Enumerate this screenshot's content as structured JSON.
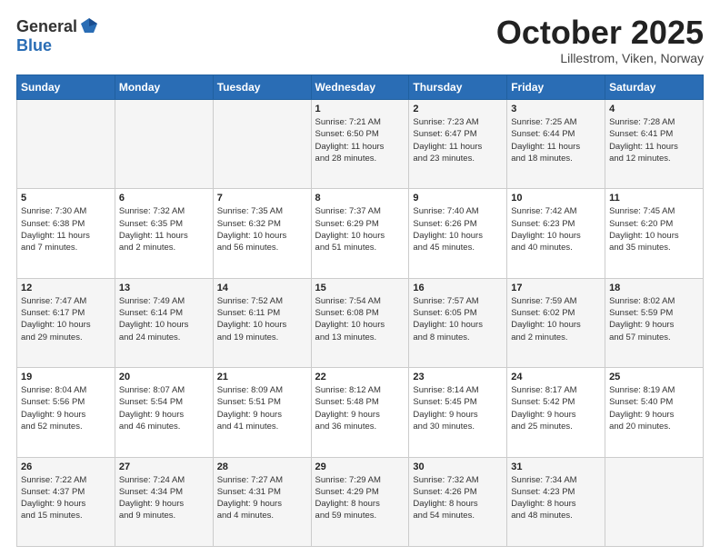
{
  "header": {
    "logo_general": "General",
    "logo_blue": "Blue",
    "month_title": "October 2025",
    "location": "Lillestrom, Viken, Norway"
  },
  "weekdays": [
    "Sunday",
    "Monday",
    "Tuesday",
    "Wednesday",
    "Thursday",
    "Friday",
    "Saturday"
  ],
  "weeks": [
    [
      {
        "day": "",
        "info": ""
      },
      {
        "day": "",
        "info": ""
      },
      {
        "day": "",
        "info": ""
      },
      {
        "day": "1",
        "info": "Sunrise: 7:21 AM\nSunset: 6:50 PM\nDaylight: 11 hours\nand 28 minutes."
      },
      {
        "day": "2",
        "info": "Sunrise: 7:23 AM\nSunset: 6:47 PM\nDaylight: 11 hours\nand 23 minutes."
      },
      {
        "day": "3",
        "info": "Sunrise: 7:25 AM\nSunset: 6:44 PM\nDaylight: 11 hours\nand 18 minutes."
      },
      {
        "day": "4",
        "info": "Sunrise: 7:28 AM\nSunset: 6:41 PM\nDaylight: 11 hours\nand 12 minutes."
      }
    ],
    [
      {
        "day": "5",
        "info": "Sunrise: 7:30 AM\nSunset: 6:38 PM\nDaylight: 11 hours\nand 7 minutes."
      },
      {
        "day": "6",
        "info": "Sunrise: 7:32 AM\nSunset: 6:35 PM\nDaylight: 11 hours\nand 2 minutes."
      },
      {
        "day": "7",
        "info": "Sunrise: 7:35 AM\nSunset: 6:32 PM\nDaylight: 10 hours\nand 56 minutes."
      },
      {
        "day": "8",
        "info": "Sunrise: 7:37 AM\nSunset: 6:29 PM\nDaylight: 10 hours\nand 51 minutes."
      },
      {
        "day": "9",
        "info": "Sunrise: 7:40 AM\nSunset: 6:26 PM\nDaylight: 10 hours\nand 45 minutes."
      },
      {
        "day": "10",
        "info": "Sunrise: 7:42 AM\nSunset: 6:23 PM\nDaylight: 10 hours\nand 40 minutes."
      },
      {
        "day": "11",
        "info": "Sunrise: 7:45 AM\nSunset: 6:20 PM\nDaylight: 10 hours\nand 35 minutes."
      }
    ],
    [
      {
        "day": "12",
        "info": "Sunrise: 7:47 AM\nSunset: 6:17 PM\nDaylight: 10 hours\nand 29 minutes."
      },
      {
        "day": "13",
        "info": "Sunrise: 7:49 AM\nSunset: 6:14 PM\nDaylight: 10 hours\nand 24 minutes."
      },
      {
        "day": "14",
        "info": "Sunrise: 7:52 AM\nSunset: 6:11 PM\nDaylight: 10 hours\nand 19 minutes."
      },
      {
        "day": "15",
        "info": "Sunrise: 7:54 AM\nSunset: 6:08 PM\nDaylight: 10 hours\nand 13 minutes."
      },
      {
        "day": "16",
        "info": "Sunrise: 7:57 AM\nSunset: 6:05 PM\nDaylight: 10 hours\nand 8 minutes."
      },
      {
        "day": "17",
        "info": "Sunrise: 7:59 AM\nSunset: 6:02 PM\nDaylight: 10 hours\nand 2 minutes."
      },
      {
        "day": "18",
        "info": "Sunrise: 8:02 AM\nSunset: 5:59 PM\nDaylight: 9 hours\nand 57 minutes."
      }
    ],
    [
      {
        "day": "19",
        "info": "Sunrise: 8:04 AM\nSunset: 5:56 PM\nDaylight: 9 hours\nand 52 minutes."
      },
      {
        "day": "20",
        "info": "Sunrise: 8:07 AM\nSunset: 5:54 PM\nDaylight: 9 hours\nand 46 minutes."
      },
      {
        "day": "21",
        "info": "Sunrise: 8:09 AM\nSunset: 5:51 PM\nDaylight: 9 hours\nand 41 minutes."
      },
      {
        "day": "22",
        "info": "Sunrise: 8:12 AM\nSunset: 5:48 PM\nDaylight: 9 hours\nand 36 minutes."
      },
      {
        "day": "23",
        "info": "Sunrise: 8:14 AM\nSunset: 5:45 PM\nDaylight: 9 hours\nand 30 minutes."
      },
      {
        "day": "24",
        "info": "Sunrise: 8:17 AM\nSunset: 5:42 PM\nDaylight: 9 hours\nand 25 minutes."
      },
      {
        "day": "25",
        "info": "Sunrise: 8:19 AM\nSunset: 5:40 PM\nDaylight: 9 hours\nand 20 minutes."
      }
    ],
    [
      {
        "day": "26",
        "info": "Sunrise: 7:22 AM\nSunset: 4:37 PM\nDaylight: 9 hours\nand 15 minutes."
      },
      {
        "day": "27",
        "info": "Sunrise: 7:24 AM\nSunset: 4:34 PM\nDaylight: 9 hours\nand 9 minutes."
      },
      {
        "day": "28",
        "info": "Sunrise: 7:27 AM\nSunset: 4:31 PM\nDaylight: 9 hours\nand 4 minutes."
      },
      {
        "day": "29",
        "info": "Sunrise: 7:29 AM\nSunset: 4:29 PM\nDaylight: 8 hours\nand 59 minutes."
      },
      {
        "day": "30",
        "info": "Sunrise: 7:32 AM\nSunset: 4:26 PM\nDaylight: 8 hours\nand 54 minutes."
      },
      {
        "day": "31",
        "info": "Sunrise: 7:34 AM\nSunset: 4:23 PM\nDaylight: 8 hours\nand 48 minutes."
      },
      {
        "day": "",
        "info": ""
      }
    ]
  ]
}
